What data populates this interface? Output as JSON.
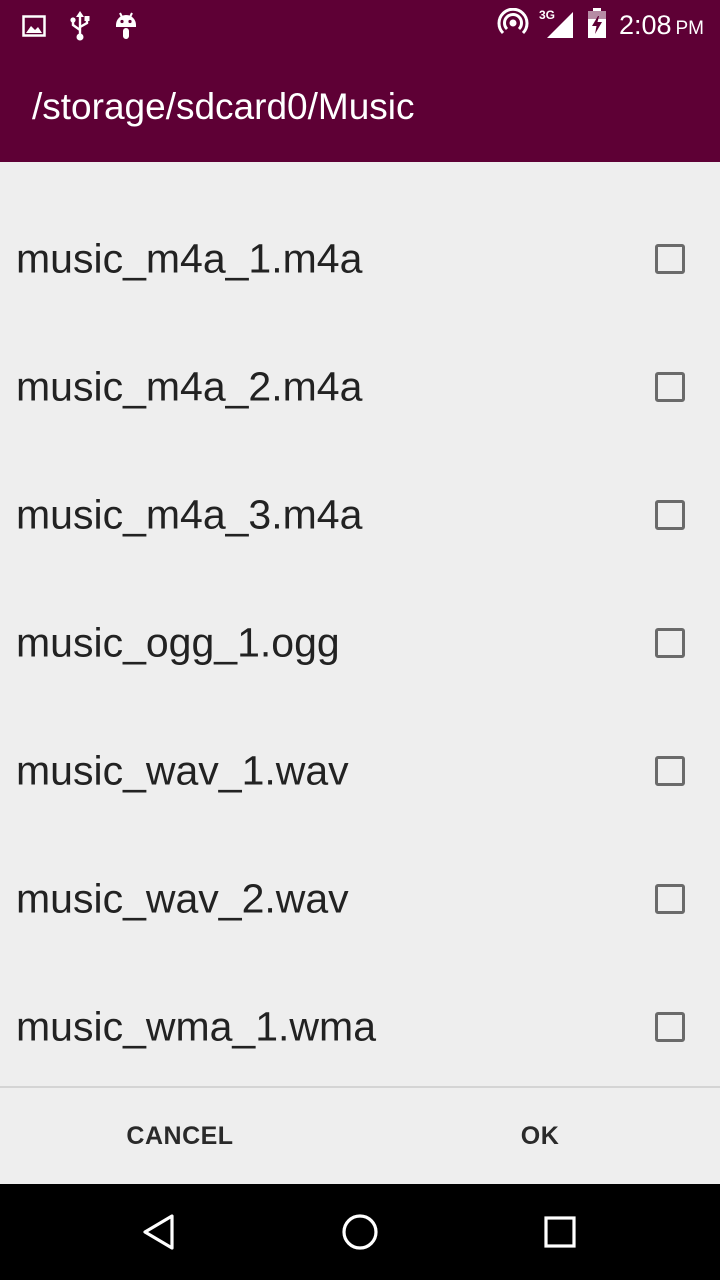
{
  "status_bar": {
    "time": "2:08",
    "ampm": "PM",
    "network_type": "3G",
    "icons": [
      "image-icon",
      "usb-icon",
      "android-icon",
      "hotspot-icon",
      "signal-icon",
      "battery-icon"
    ]
  },
  "app_bar": {
    "title": "/storage/sdcard0/Music"
  },
  "files": [
    {
      "name": "music_m4a_1.m4a",
      "checked": false
    },
    {
      "name": "music_m4a_2.m4a",
      "checked": false
    },
    {
      "name": "music_m4a_3.m4a",
      "checked": false
    },
    {
      "name": "music_ogg_1.ogg",
      "checked": false
    },
    {
      "name": "music_wav_1.wav",
      "checked": false
    },
    {
      "name": "music_wav_2.wav",
      "checked": false
    },
    {
      "name": "music_wma_1.wma",
      "checked": false
    }
  ],
  "dialog": {
    "cancel_label": "CANCEL",
    "ok_label": "OK"
  },
  "colors": {
    "primary_dark": "#5e0035",
    "background": "#eeeeee",
    "text": "#222222"
  }
}
